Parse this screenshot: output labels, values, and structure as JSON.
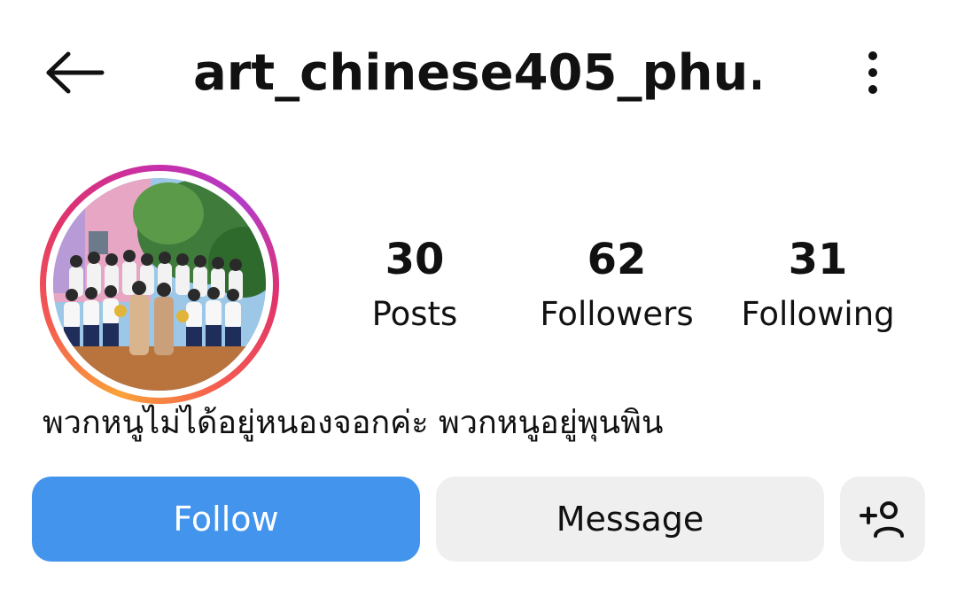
{
  "header": {
    "username": "art_chinese405_phu...",
    "back_icon": "arrow-left-icon",
    "more_icon": "more-vertical-icon"
  },
  "profile": {
    "avatar_icon": "profile-photo",
    "avatar_ring_colors": [
      "#f9a23a",
      "#f45b4f",
      "#e0336b",
      "#c72fa6",
      "#b43bc8"
    ],
    "stats": {
      "posts": {
        "value": "30",
        "label": "Posts"
      },
      "followers": {
        "value": "62",
        "label": "Followers"
      },
      "following": {
        "value": "31",
        "label": "Following"
      }
    },
    "bio": "พวกหนูไม่ได้อยู่หนองจอกค่ะ พวกหนูอยู่พุนพิน"
  },
  "actions": {
    "follow_label": "Follow",
    "message_label": "Message",
    "add_user_icon": "add-user-icon",
    "follow_color": "#4394ec",
    "secondary_color": "#efefef"
  }
}
